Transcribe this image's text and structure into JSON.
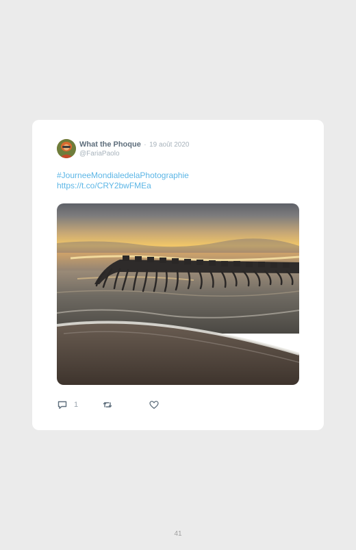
{
  "tweet": {
    "author_name": "What the Phoque",
    "separator": "·",
    "date": "19 août 2020",
    "handle": "@FariaPaolo",
    "hashtag": "#JourneeMondialedelaPhotographie",
    "link": "https://t.co/CRY2bwFMEa",
    "reply_count": "1"
  },
  "icons": {
    "reply": "speech-bubble-icon",
    "retweet": "retweet-icon",
    "like": "heart-icon"
  },
  "colors": {
    "background": "#ebebeb",
    "card": "#ffffff",
    "link": "#5cb6e6",
    "name": "#5e6e7c",
    "muted": "#a7b2bb"
  },
  "page": {
    "number": "41"
  }
}
